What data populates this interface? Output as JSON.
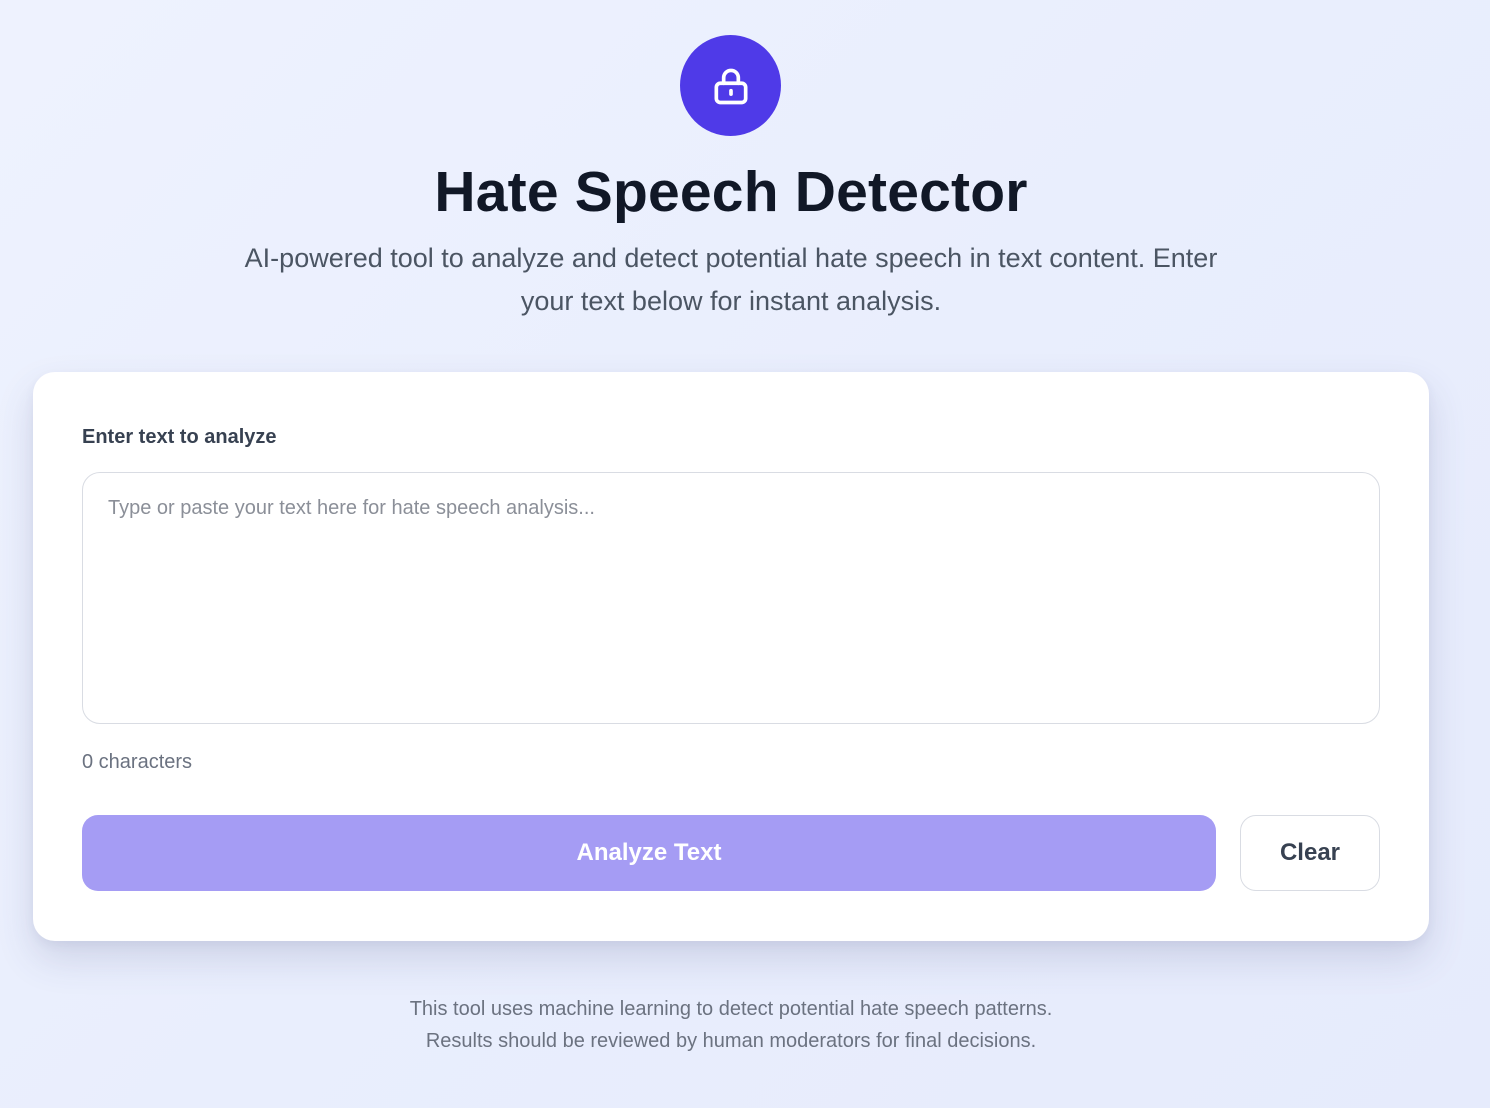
{
  "header": {
    "icon": "lock-icon",
    "title": "Hate Speech Detector",
    "subtitle": "AI-powered tool to analyze and detect potential hate speech in text content. Enter your text below for instant analysis."
  },
  "form": {
    "label": "Enter text to analyze",
    "textarea_value": "",
    "textarea_placeholder": "Type or paste your text here for hate speech analysis...",
    "char_count": "0 characters",
    "analyze_label": "Analyze Text",
    "clear_label": "Clear"
  },
  "footer": {
    "line1": "This tool uses machine learning to detect potential hate speech patterns.",
    "line2": "Results should be reviewed by human moderators for final decisions."
  },
  "colors": {
    "accent": "#4f3ae8",
    "analyze_button_disabled": "#a59cf4",
    "background": "#eef2fe"
  }
}
